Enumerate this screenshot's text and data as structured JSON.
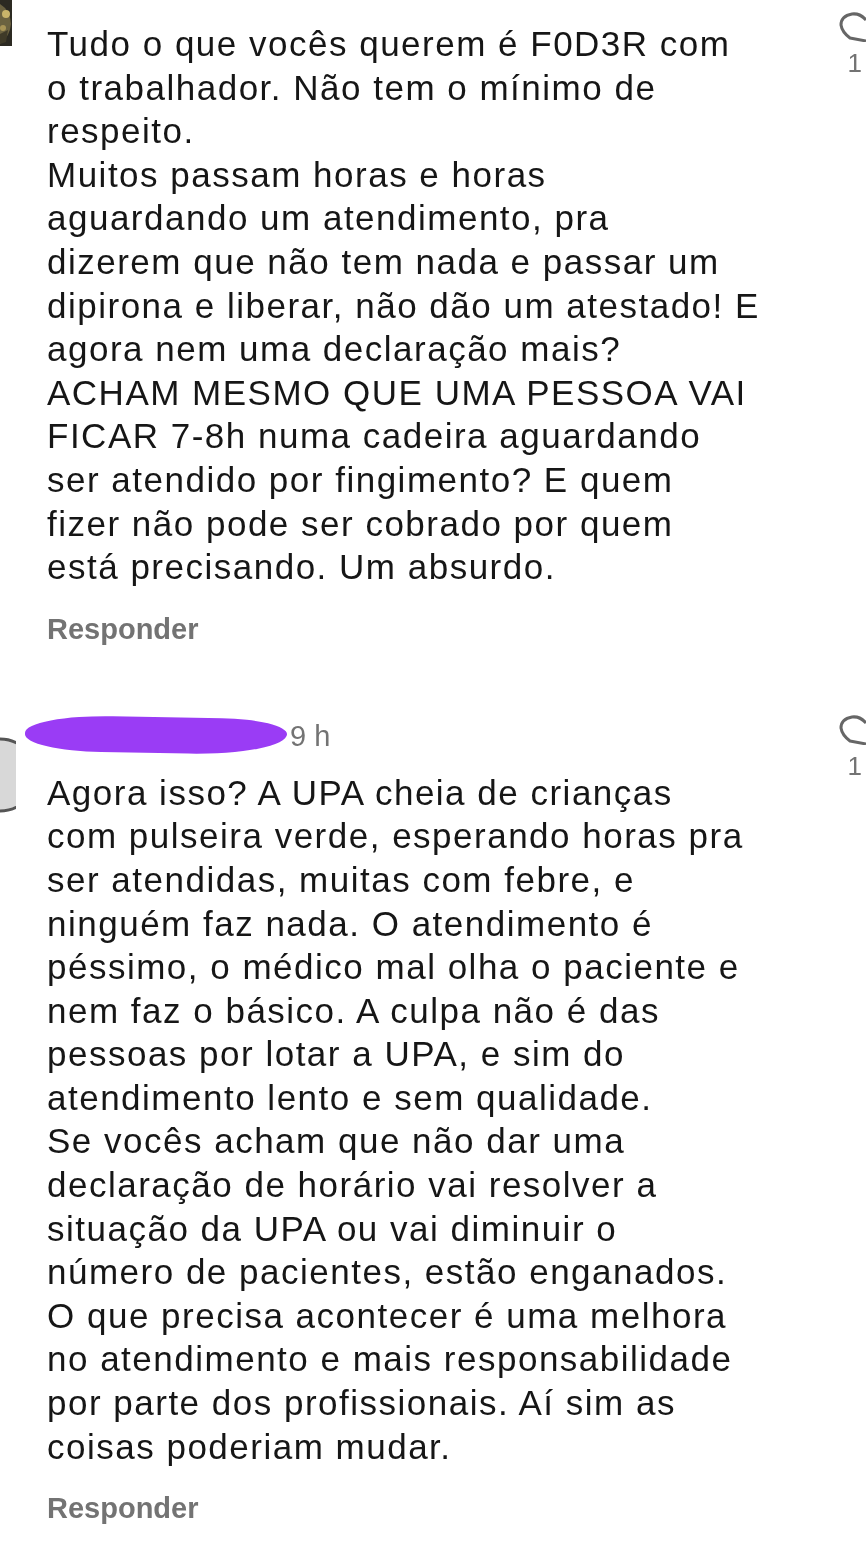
{
  "comments": [
    {
      "lines": [
        "Tudo o que vocês querem é F0D3R com",
        "o trabalhador. Não tem o mínimo de",
        "respeito.",
        "Muitos passam horas e horas",
        "aguardando um atendimento, pra",
        "dizerem que não tem nada e passar um",
        "dipirona e liberar, não dão um atestado! E",
        "agora nem uma declaração mais?",
        "ACHAM MESMO QUE UMA PESSOA VAI",
        "FICAR 7-8h numa cadeira aguardando",
        "ser atendido por fingimento? E quem",
        "fizer não pode ser cobrado por quem",
        "está precisando. Um absurdo."
      ],
      "reply": "Responder",
      "likes": "1"
    },
    {
      "time": "9 h",
      "lines": [
        "Agora isso? A UPA cheia de crianças",
        "com pulseira verde, esperando horas pra",
        "ser atendidas, muitas com febre, e",
        "ninguém faz nada. O atendimento é",
        "péssimo, o médico mal olha o paciente e",
        "nem faz o básico. A culpa não é das",
        "pessoas por lotar a UPA, e sim do",
        "atendimento lento e sem qualidade.",
        "Se vocês acham que não dar uma",
        "declaração de horário vai resolver a",
        "situação da UPA ou vai diminuir o",
        "número de pacientes, estão enganados.",
        "O que precisa acontecer é uma melhora",
        "no atendimento e mais responsabilidade",
        "por parte dos profissionais. Aí sim as",
        "coisas poderiam mudar."
      ],
      "reply": "Responder",
      "likes": "1"
    }
  ]
}
